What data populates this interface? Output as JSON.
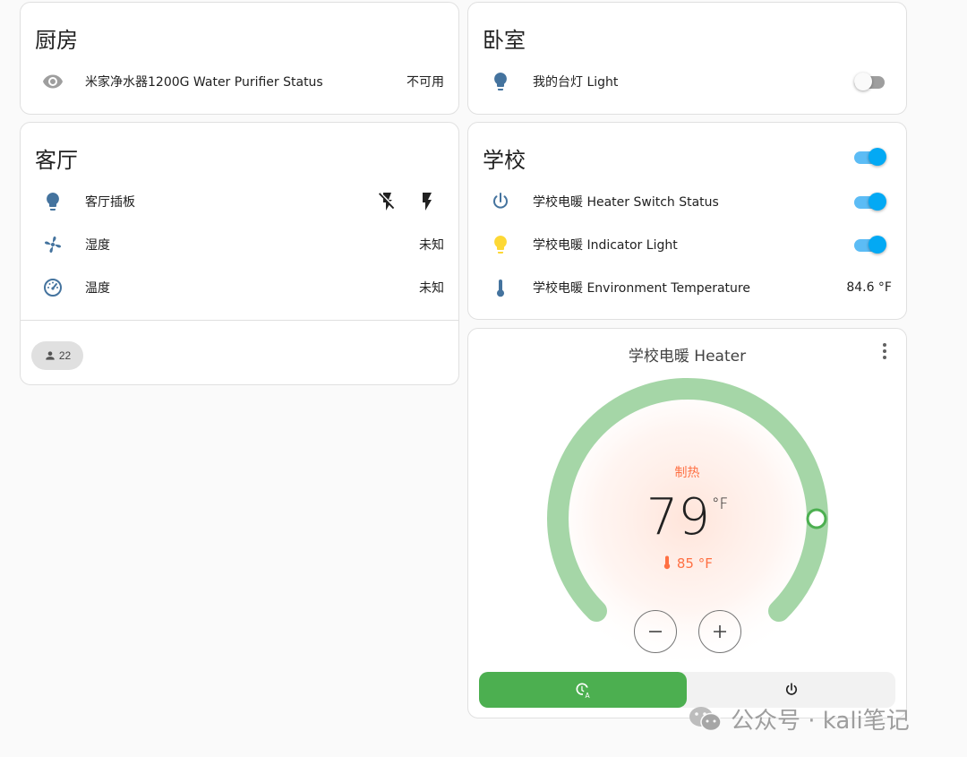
{
  "kitchen": {
    "title": "厨房",
    "rows": [
      {
        "name": "米家净水器1200G Water Purifier Status",
        "state": "不可用",
        "icon": "eye-icon"
      }
    ]
  },
  "bedroom": {
    "title": "卧室",
    "rows": [
      {
        "name": "我的台灯 Light",
        "state": "off",
        "icon": "lightbulb-icon"
      }
    ]
  },
  "living_room": {
    "title": "客厅",
    "rows": [
      {
        "name": "客厅插板",
        "icon": "lightbulb-icon",
        "actions": [
          "flash-off-icon",
          "flash-icon"
        ]
      },
      {
        "name": "湿度",
        "state": "未知",
        "icon": "fan-icon"
      },
      {
        "name": "温度",
        "state": "未知",
        "icon": "gauge-icon"
      }
    ],
    "footer_badge": "22",
    "footer_badge_icon": "person-icon"
  },
  "school": {
    "title": "学校",
    "header_toggle": "on",
    "rows": [
      {
        "name": "学校电暖 Heater Switch Status",
        "state": "on",
        "icon": "power-icon"
      },
      {
        "name": "学校电暖 Indicator Light",
        "state": "on",
        "icon": "lightbulb-icon"
      },
      {
        "name": "学校电暖 Environment Temperature",
        "state": "84.6 °F",
        "icon": "thermometer-icon"
      }
    ]
  },
  "thermostat": {
    "name": "学校电暖 Heater",
    "action": "制热",
    "target": "79",
    "unit": "°F",
    "current": "85 °F",
    "modes": [
      {
        "mode": "auto",
        "icon": "thermostat-auto-icon",
        "active": true
      },
      {
        "mode": "off",
        "icon": "power-icon",
        "active": false
      }
    ]
  },
  "watermark": {
    "text": "公众号 · kali笔记"
  },
  "colors": {
    "accent": "#03a9f4",
    "entity_icon": "#44739e",
    "light_on": "#fdd835",
    "heat": "#ff7043",
    "arc": "#a5d6a7",
    "mode_active": "#4caf50"
  }
}
